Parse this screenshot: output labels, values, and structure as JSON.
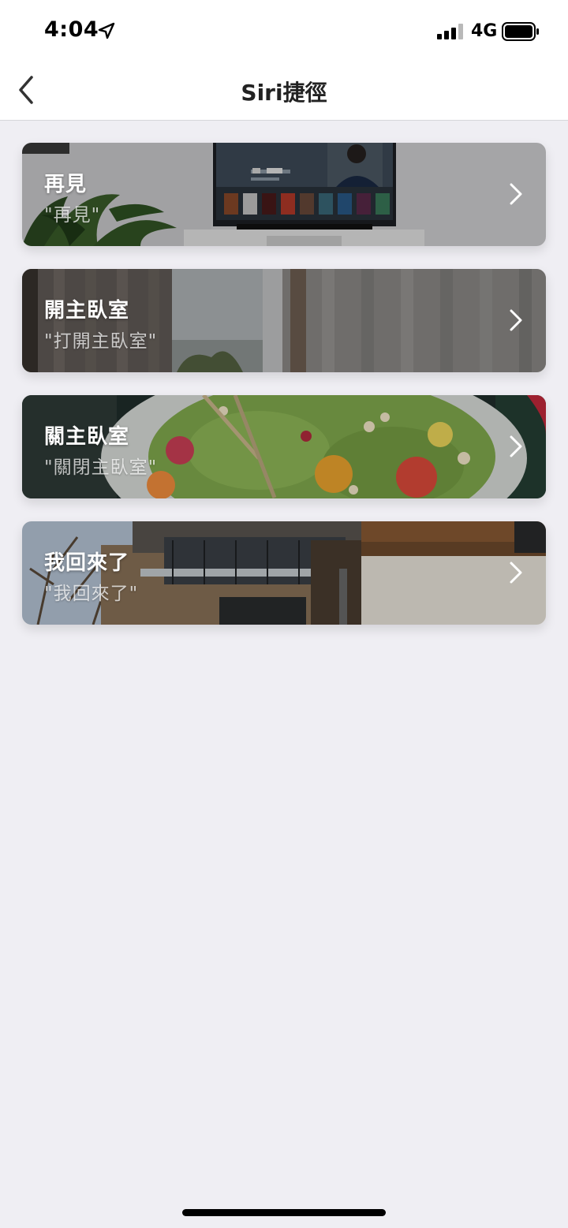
{
  "status_bar": {
    "time": "4:04",
    "network": "4G",
    "location_icon": "location-arrow-icon",
    "signal_icon": "cellular-signal-icon",
    "battery_icon": "battery-icon"
  },
  "nav": {
    "title": "Siri捷徑",
    "back_icon": "chevron-left-icon"
  },
  "shortcuts": [
    {
      "title": "再見",
      "phrase": "\"再見\"",
      "image": "living-room-tv-photo"
    },
    {
      "title": "開主臥室",
      "phrase": "\"打開主臥室\"",
      "image": "bedroom-window-curtains-photo"
    },
    {
      "title": "關主臥室",
      "phrase": "\"關閉主臥室\"",
      "image": "salad-bowl-photo"
    },
    {
      "title": "我回來了",
      "phrase": "\"我回來了\"",
      "image": "house-exterior-photo"
    }
  ],
  "colors": {
    "background": "#efeef3",
    "nav_background": "#ffffff",
    "title_text": "#222222",
    "card_text": "#ffffff"
  }
}
